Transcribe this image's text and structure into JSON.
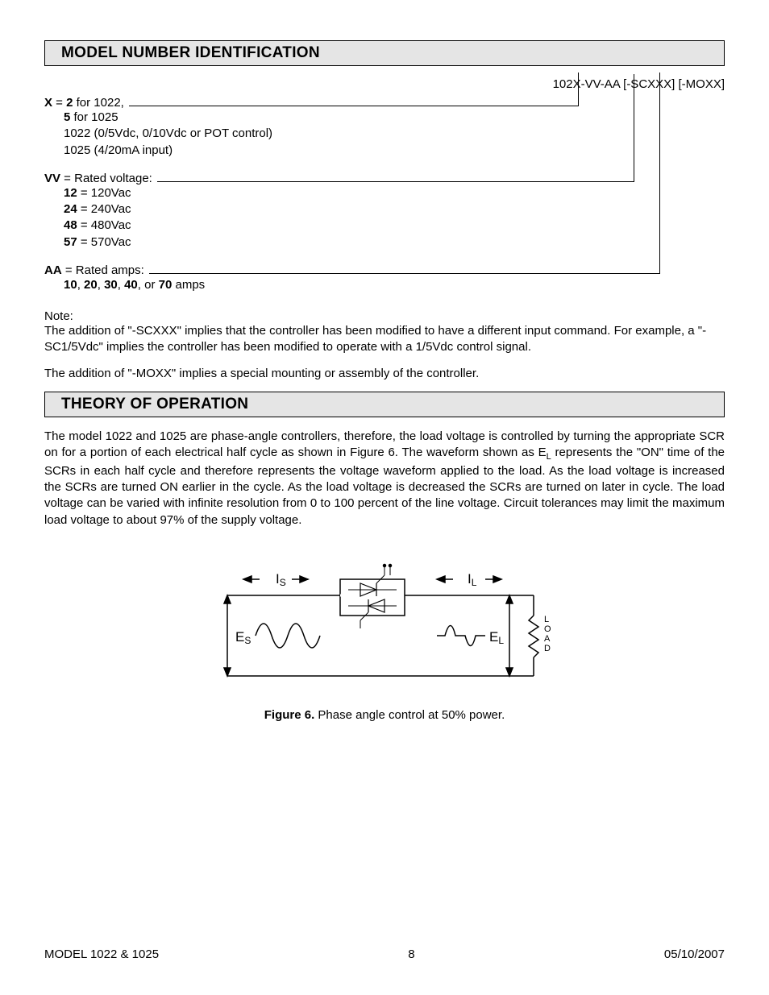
{
  "section1_title": "MODEL NUMBER IDENTIFICATION",
  "model_string": "102X-VV-AA [-SCXXX] [-MOXX]",
  "x": {
    "label_pre": "X",
    "label_eq": " = ",
    "label_val": "2",
    "label_post": " for 1022,",
    "line1_pre": "5",
    "line1_post": " for 1025",
    "line2": "1022 (0/5Vdc, 0/10Vdc or POT control)",
    "line3": "1025 (4/20mA input)"
  },
  "vv": {
    "label_pre": "VV",
    "label_post": " = Rated voltage:",
    "r1a": "12",
    "r1b": " = 120Vac",
    "r2a": "24",
    "r2b": " = 240Vac",
    "r3a": "48",
    "r3b": " = 480Vac",
    "r4a": "57",
    "r4b": " = 570Vac"
  },
  "aa": {
    "label_pre": "AA",
    "label_post": " = Rated amps:",
    "v1": "10",
    "s1": ", ",
    "v2": "20",
    "s2": ", ",
    "v3": "30",
    "s3": ", ",
    "v4": "40",
    "s4": ", or ",
    "v5": "70",
    "s5": " amps"
  },
  "note_label": "Note:",
  "note_p1": "The addition of \"-SCXXX\" implies that the controller has been modified to have a different input command.  For example, a \"-SC1/5Vdc\" implies the controller has been modified to operate with a 1/5Vdc control signal.",
  "note_p2": "The addition of \"-MOXX\" implies a special mounting or assembly of the controller.",
  "section2_title": "THEORY OF OPERATION",
  "theory_p_a": "The model 1022 and 1025 are phase-angle controllers, therefore, the load voltage is controlled by turning the appropriate SCR on for a portion of each electrical half cycle as shown in Figure 6. The waveform shown as E",
  "theory_p_b": " represents the \"ON\" time of the SCRs in each half cycle and therefore represents the voltage waveform applied to the load.  As the load voltage is increased the SCRs are turned ON earlier in the cycle.  As the load voltage is decreased the SCRs are turned on later in cycle.  The load voltage can be varied with infinite resolution from 0 to 100 percent of the line voltage.  Circuit tolerances may limit the maximum load voltage to about 97% of the supply voltage.",
  "theory_sub": "L",
  "figure": {
    "Is": "I",
    "Is_sub": "S",
    "Il": "I",
    "Il_sub": "L",
    "Es": "E",
    "Es_sub": "S",
    "El": "E",
    "El_sub": "L",
    "load_L": "L",
    "load_O": "O",
    "load_A": "A",
    "load_D": "D"
  },
  "fig_caption_label": "Figure 6.",
  "fig_caption_text": "  Phase angle control at 50% power.",
  "footer_left": "MODEL 1022 & 1025",
  "footer_center": "8",
  "footer_right": "05/10/2007"
}
